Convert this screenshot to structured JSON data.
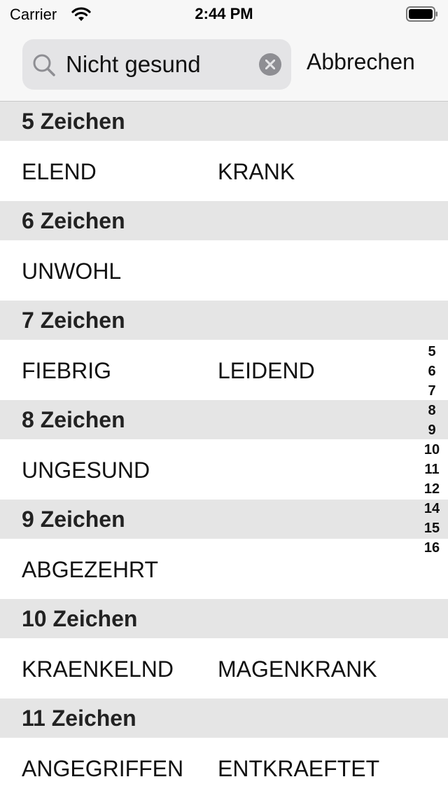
{
  "status": {
    "carrier": "Carrier",
    "time": "2:44 PM"
  },
  "search": {
    "value": "Nicht gesund",
    "cancel_label": "Abbrechen"
  },
  "sections": [
    {
      "header": "5 Zeichen",
      "words": [
        "ELEND",
        "KRANK"
      ]
    },
    {
      "header": "6 Zeichen",
      "words": [
        "UNWOHL"
      ]
    },
    {
      "header": "7 Zeichen",
      "words": [
        "FIEBRIG",
        "LEIDEND"
      ]
    },
    {
      "header": "8 Zeichen",
      "words": [
        "UNGESUND"
      ]
    },
    {
      "header": "9 Zeichen",
      "words": [
        "ABGEZEHRT"
      ]
    },
    {
      "header": "10 Zeichen",
      "words": [
        "KRAENKELND",
        "MAGENKRANK"
      ]
    },
    {
      "header": "11 Zeichen",
      "words": [
        "ANGEGRIFFEN",
        "ENTKRAEFTET"
      ]
    }
  ],
  "index": [
    "5",
    "6",
    "7",
    "8",
    "9",
    "10",
    "11",
    "12",
    "14",
    "15",
    "16"
  ]
}
